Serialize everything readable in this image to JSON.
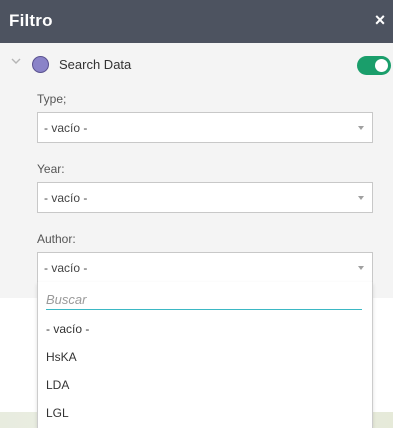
{
  "header": {
    "title": "Filtro",
    "close_glyph": "×"
  },
  "layer": {
    "name": "Search Data",
    "enabled": true,
    "dot_color": "#8a83c8",
    "toggle_color": "#1a9e6b"
  },
  "filters": [
    {
      "label": "Type;",
      "value": "- vacío -"
    },
    {
      "label": "Year:",
      "value": "- vacío -"
    },
    {
      "label": "Author:",
      "value": "- vacío -"
    }
  ],
  "dropdown": {
    "search_placeholder": "Buscar",
    "options": [
      "- vacío -",
      "HsKA",
      "LDA",
      "LGL"
    ]
  },
  "colors": {
    "header_bg": "#4d5360",
    "accent": "#3bb8c4"
  }
}
